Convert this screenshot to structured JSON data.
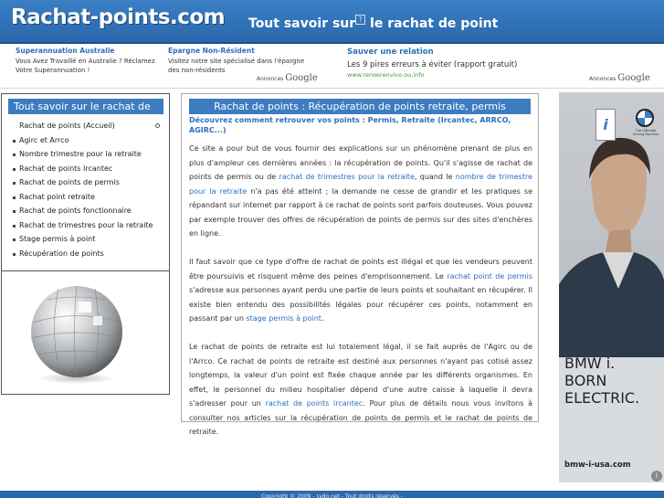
{
  "header": {
    "logo": "Rachat-points.com",
    "tagline_before": "Tout savoir sur",
    "tagline_after": "le rachat de point",
    "broken_image_glyph": "?"
  },
  "ads": {
    "ad1": {
      "title": "Superannuation Australie",
      "text": "Vous Avez Travaillé en Australie ? Réclamez Votre Superannuation !"
    },
    "ad2": {
      "title": "Epargne Non-Résident",
      "text": "Visitez notre site spécialisé dans l'épargne des non-résidents"
    },
    "ad3": {
      "title": "Sauver une relation",
      "text": "Les 9 pires erreurs à éviter (rapport gratuit)",
      "url": "www.renoerenvivo.ou.info"
    },
    "adsby_label": "Annonces",
    "adsby_brand": "Google"
  },
  "sidebar": {
    "title": "Tout savoir sur le rachat de",
    "items": [
      {
        "label": "Rachat de points (Accueil)"
      },
      {
        "label": "Agirc et Arrco"
      },
      {
        "label": "Nombre trimestre pour la retraite"
      },
      {
        "label": "Rachat de points Ircantec"
      },
      {
        "label": "Rachat de points de permis"
      },
      {
        "label": "Rachat point retraite"
      },
      {
        "label": "Rachat de points fonctionnaire"
      },
      {
        "label": "Rachat de trimestres pour la retraite"
      },
      {
        "label": "Stage permis à point"
      },
      {
        "label": "Récupération de points"
      }
    ]
  },
  "main": {
    "title": "Rachat de points : Récupération de points retraite, permis",
    "subtitle": "Découvrez comment retrouver vos points : Permis, Retraite (Ircantec, ARRCO, AGIRC...)",
    "p1": {
      "t1": "Ce site a pour but de vous fournir des explications sur un phénomène prenant de plus en plus d'ampleur ces dernières années : la récupération de points. Qu'il s'agisse de rachat de points de permis ou de ",
      "link1": "rachat de trimestres pour la retraite",
      "t2": ", quand le ",
      "link2": "nombre de trimestre pour la retraite",
      "t3": " n'a pas été atteint ; la demande ne cesse de grandir et les pratiques se répandant sur internet par rapport à ce rachat de points sont parfois douteuses. Vous pouvez par exemple trouver des offres de récupération de points de permis sur des sites d'enchères en ligne."
    },
    "p2": {
      "t1": "Il faut savoir que ce type d'offre de rachat de points est illégal et que les vendeurs peuvent être poursuivis et risquent même des peines d'emprisonnement. Le ",
      "link1": "rachat point de permis",
      "t2": " s'adresse aux personnes ayant perdu une partie de leurs points et souhaitant en récupérer. Il existe bien entendu des possibilités légales pour récupérer ces points, notamment en passant par un ",
      "link2": "stage permis à point",
      "t3": "."
    },
    "p3": {
      "t1": "Le rachat de points de retraite est lui totalement légal, il se fait auprès de l'Agirc ou de l'Arrco. Ce rachat de points de retraite est destiné aux personnes n'ayant pas cotisé assez longtemps, la valeur d'un point est fixée chaque année par les différents organismes. En effet, le personnel du milieu hospitalier dépend d'une autre caisse à laquelle il devra s'adresser pour un ",
      "link1": "rachat de points ircantec",
      "t2": ". Pour plus de détails nous vous invitons à consulter nos articles sur la récupération de points de permis et le rachat de points de retraite."
    }
  },
  "bmw_ad": {
    "line1": "BMW i.",
    "line2": "BORN",
    "line3": "ELECTRIC.",
    "url": "bmw-i-usa.com",
    "i_badge": "i",
    "small_text": "The Ultimate Driving Machine",
    "close_glyph": "i"
  },
  "footer": {
    "text": "Copyright © 2009 - Lydo.net - Tout droits réservés -"
  },
  "colors": {
    "header_blue": "#2a68ad",
    "title_bar_blue": "#3d7cc0",
    "link_blue": "#2a6fbf",
    "ad_url_green": "#3a9a3a"
  }
}
